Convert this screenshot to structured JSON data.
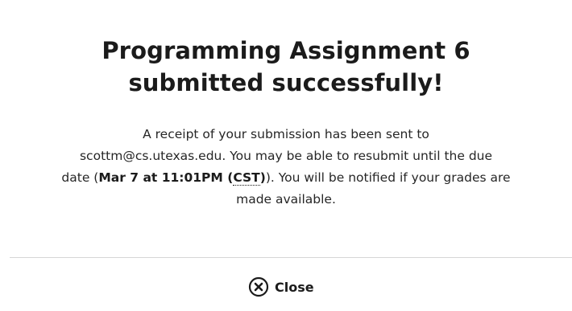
{
  "dialog": {
    "title_line1": "Programming Assignment 6",
    "title_line2": "submitted successfully!",
    "message_part1": "A receipt of your submission has been sent to",
    "message_part2": "scottm@cs.utexas.edu. You may be able to resubmit until the due",
    "message_part3": "date (",
    "due_date": "Mar 7 at 11:01PM (",
    "timezone": "CST",
    "due_date_close": ")",
    "message_part4": "). You will be notified if your grades are",
    "message_part5": "made available.",
    "close_label": "Close",
    "close_icon": "close-circle-icon"
  }
}
